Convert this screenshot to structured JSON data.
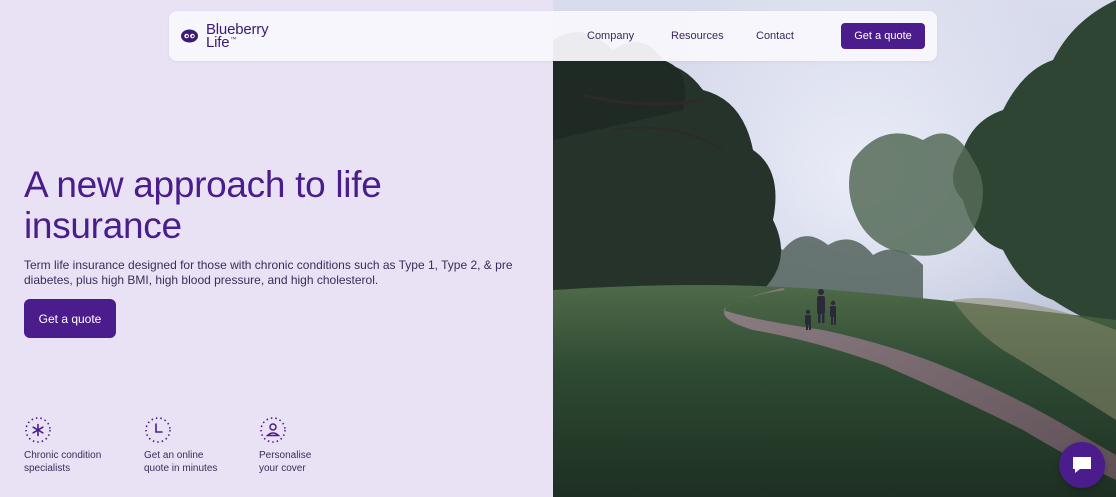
{
  "brand": {
    "name_line1": "Blueberry",
    "name_line2": "Life",
    "trademark": "™",
    "logo_icon": "blueberry-eyes-icon"
  },
  "nav": {
    "links": [
      "Company",
      "Resources",
      "Contact"
    ],
    "cta_label": "Get a quote"
  },
  "hero": {
    "title": "A new approach to life insurance",
    "subtitle": "Term life insurance designed for those with chronic conditions such as Type 1, Type 2, & pre diabetes, plus high BMI, high blood pressure, and high cholesterol.",
    "cta_label": "Get a quote",
    "image_icon": "family-walking-park-photo"
  },
  "features": [
    {
      "icon": "asterisk-icon",
      "label": "Chronic condition\nspecialists"
    },
    {
      "icon": "clock-icon",
      "label": "Get an online\nquote in minutes"
    },
    {
      "icon": "person-icon",
      "label": "Personalise\nyour cover"
    }
  ],
  "chat": {
    "icon": "chat-bubble-icon"
  },
  "colors": {
    "brand_purple": "#4a1c8c",
    "background": "#e8e2f4",
    "nav_background": "#f8f7fc",
    "text": "#3a2c5c"
  }
}
